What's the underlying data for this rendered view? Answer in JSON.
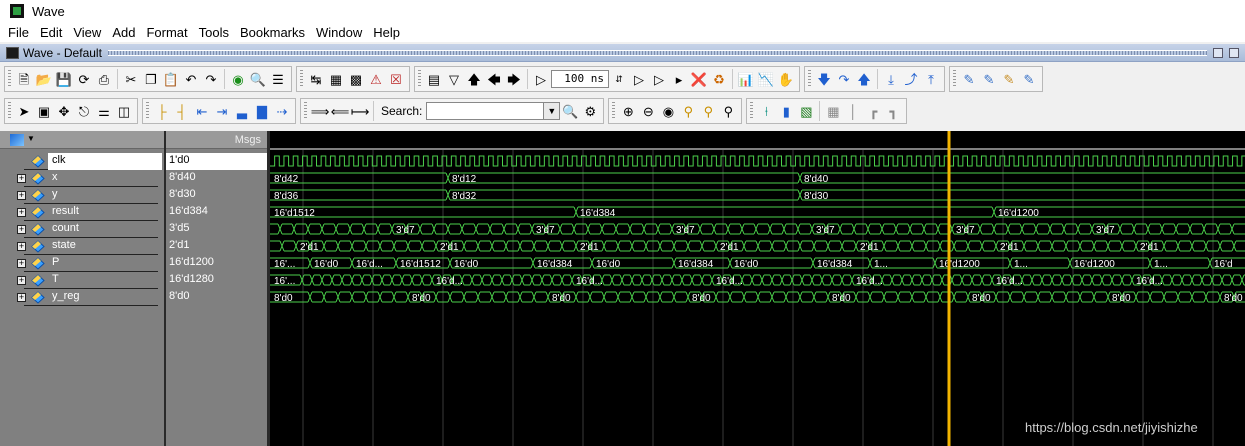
{
  "window": {
    "title": "Wave"
  },
  "menu": [
    "File",
    "Edit",
    "View",
    "Add",
    "Format",
    "Tools",
    "Bookmarks",
    "Window",
    "Help"
  ],
  "wave_window": {
    "title": "Wave - Default"
  },
  "toolbar": {
    "time_value": "100 ns",
    "search_label": "Search:",
    "search_value": ""
  },
  "panes": {
    "values_header": "Msgs"
  },
  "signals": [
    {
      "name": "clk",
      "value": "1'd0",
      "expandable": false,
      "selected": true
    },
    {
      "name": "x",
      "value": "8'd40",
      "expandable": true
    },
    {
      "name": "y",
      "value": "8'd30",
      "expandable": true
    },
    {
      "name": "result",
      "value": "16'd384",
      "expandable": true
    },
    {
      "name": "count",
      "value": "3'd5",
      "expandable": true
    },
    {
      "name": "state",
      "value": "2'd1",
      "expandable": true
    },
    {
      "name": "P",
      "value": "16'd1200",
      "expandable": true
    },
    {
      "name": "T",
      "value": "16'd1280",
      "expandable": true
    },
    {
      "name": "y_reg",
      "value": "8'd0",
      "expandable": true
    }
  ],
  "waves": {
    "x": [
      "8'd42",
      "8'd12",
      "8'd40"
    ],
    "y": [
      "8'd36",
      "8'd32",
      "8'd30"
    ],
    "result": [
      "16'd1512",
      "16'd384",
      "16'd1200"
    ],
    "count_label": "3'd7",
    "state_label": "2'd1",
    "p_labels": [
      "16'...",
      "16'd0",
      "16'd...",
      "16'd1512",
      "16'd0",
      "16'd384",
      "16'd0",
      "16'd384",
      "16'd0",
      "16'd384",
      "1...",
      "16'd1200",
      "1...",
      "16'd1200",
      "1...",
      "16'd"
    ],
    "t_labels": [
      "16'...",
      "16'd...",
      "16'd...",
      "16'd...",
      "16'd...",
      "16'd...",
      "16'd..."
    ],
    "y_reg_label": "8'd0"
  },
  "colors": {
    "wave": "#4bd14b",
    "cursor": "#f2b400",
    "grid": "#3a3a3a",
    "background": "#000000"
  },
  "watermark": "https://blog.csdn.net/jiyishizhe"
}
